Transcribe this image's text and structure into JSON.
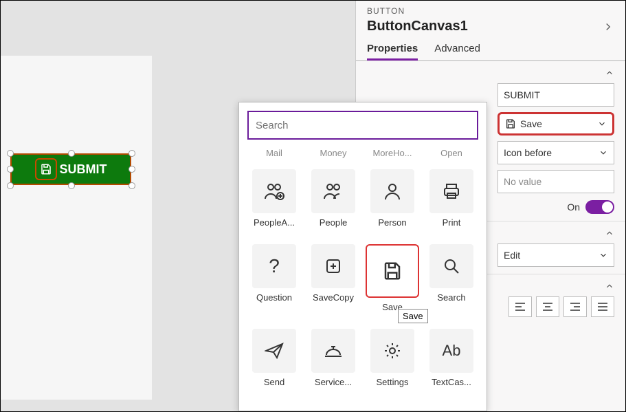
{
  "panel": {
    "type_label": "BUTTON",
    "control_name": "ButtonCanvas1",
    "tabs": {
      "properties": "Properties",
      "advanced": "Advanced"
    },
    "text_value": "SUBMIT",
    "icon_value": "Save",
    "layout_value": "Icon before",
    "novalue": "No value",
    "toggle_label": "On",
    "display_mode": "Edit"
  },
  "canvas": {
    "button_text": "SUBMIT"
  },
  "popup": {
    "search_placeholder": "Search",
    "tooltip": "Save",
    "row0": [
      "Mail",
      "Money",
      "MoreHo...",
      "Open"
    ],
    "row1": [
      "PeopleA...",
      "People",
      "Person",
      "Print"
    ],
    "row2": [
      "Question",
      "SaveCopy",
      "Save",
      "Search"
    ],
    "row3": [
      "Send",
      "Service...",
      "Settings",
      "TextCas..."
    ]
  }
}
